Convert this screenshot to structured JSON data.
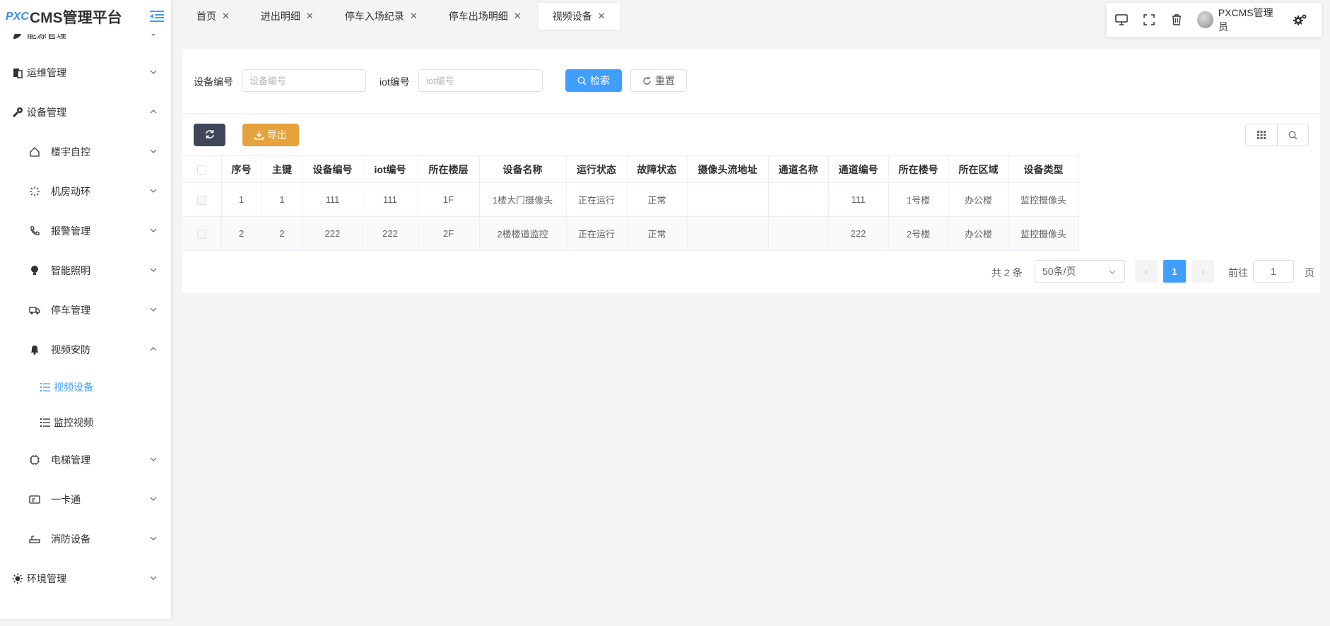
{
  "brand": {
    "logo": "PXC",
    "title": "CMS管理平台"
  },
  "sidebar": {
    "items": [
      {
        "label": "能源管理",
        "icon": "leaf-icon",
        "expanded": false
      },
      {
        "label": "运维管理",
        "icon": "clipboard-icon",
        "expanded": false
      },
      {
        "label": "设备管理",
        "icon": "wrench-icon",
        "expanded": true
      },
      {
        "label": "楼宇自控",
        "icon": "home-icon",
        "expanded": false
      },
      {
        "label": "机房动环",
        "icon": "spinner-icon",
        "expanded": false
      },
      {
        "label": "报警管理",
        "icon": "phone-icon",
        "expanded": false
      },
      {
        "label": "智能照明",
        "icon": "bulb-icon",
        "expanded": false
      },
      {
        "label": "停车管理",
        "icon": "truck-icon",
        "expanded": false
      },
      {
        "label": "视频安防",
        "icon": "bell-icon",
        "expanded": true
      },
      {
        "label": "视频设备",
        "icon": "list-icon",
        "active": true
      },
      {
        "label": "监控视频",
        "icon": "list-icon",
        "active": false
      },
      {
        "label": "电梯管理",
        "icon": "chip-icon",
        "expanded": false
      },
      {
        "label": "一卡通",
        "icon": "card-icon",
        "expanded": false
      },
      {
        "label": "消防设备",
        "icon": "sensor-icon",
        "expanded": false
      },
      {
        "label": "环境管理",
        "icon": "sun-icon",
        "expanded": false
      }
    ]
  },
  "tabs": [
    {
      "label": "首页",
      "active": false
    },
    {
      "label": "进出明细",
      "active": false
    },
    {
      "label": "停车入场纪录",
      "active": false
    },
    {
      "label": "停车出场明细",
      "active": false
    },
    {
      "label": "视频设备",
      "active": true
    }
  ],
  "toolbar": {
    "username": "PXCMS管理员",
    "icons": [
      "monitor-icon",
      "fullscreen-icon",
      "trash-icon",
      "avatar",
      "settings-icon"
    ]
  },
  "search": {
    "device_no_label": "设备编号",
    "device_no_placeholder": "设备编号",
    "device_no_value": "",
    "iot_label": "iot编号",
    "iot_placeholder": "iot编号",
    "iot_value": "",
    "search_label": "检索",
    "reset_label": "重置"
  },
  "actions": {
    "export_label": "导出"
  },
  "table": {
    "columns": [
      "序号",
      "主键",
      "设备编号",
      "iot编号",
      "所在楼层",
      "设备名称",
      "运行状态",
      "故障状态",
      "摄像头流地址",
      "通道名称",
      "通道编号",
      "所在楼号",
      "所在区域",
      "设备类型"
    ],
    "rows": [
      [
        "1",
        "1",
        "111",
        "111",
        "1F",
        "1楼大门摄像头",
        "正在运行",
        "正常",
        "",
        "",
        "111",
        "1号楼",
        "办公楼",
        "监控摄像头"
      ],
      [
        "2",
        "2",
        "222",
        "222",
        "2F",
        "2楼楼道监控",
        "正在运行",
        "正常",
        "",
        "",
        "222",
        "2号楼",
        "办公楼",
        "监控摄像头"
      ]
    ]
  },
  "pagination": {
    "total_text": "共 2 条",
    "page_size": "50条/页",
    "current_page": "1",
    "goto_label": "前往",
    "goto_value": "1",
    "page_suffix": "页"
  },
  "colors": {
    "primary": "#409eff",
    "warning": "#e6a23c",
    "dark": "#3f4659"
  }
}
